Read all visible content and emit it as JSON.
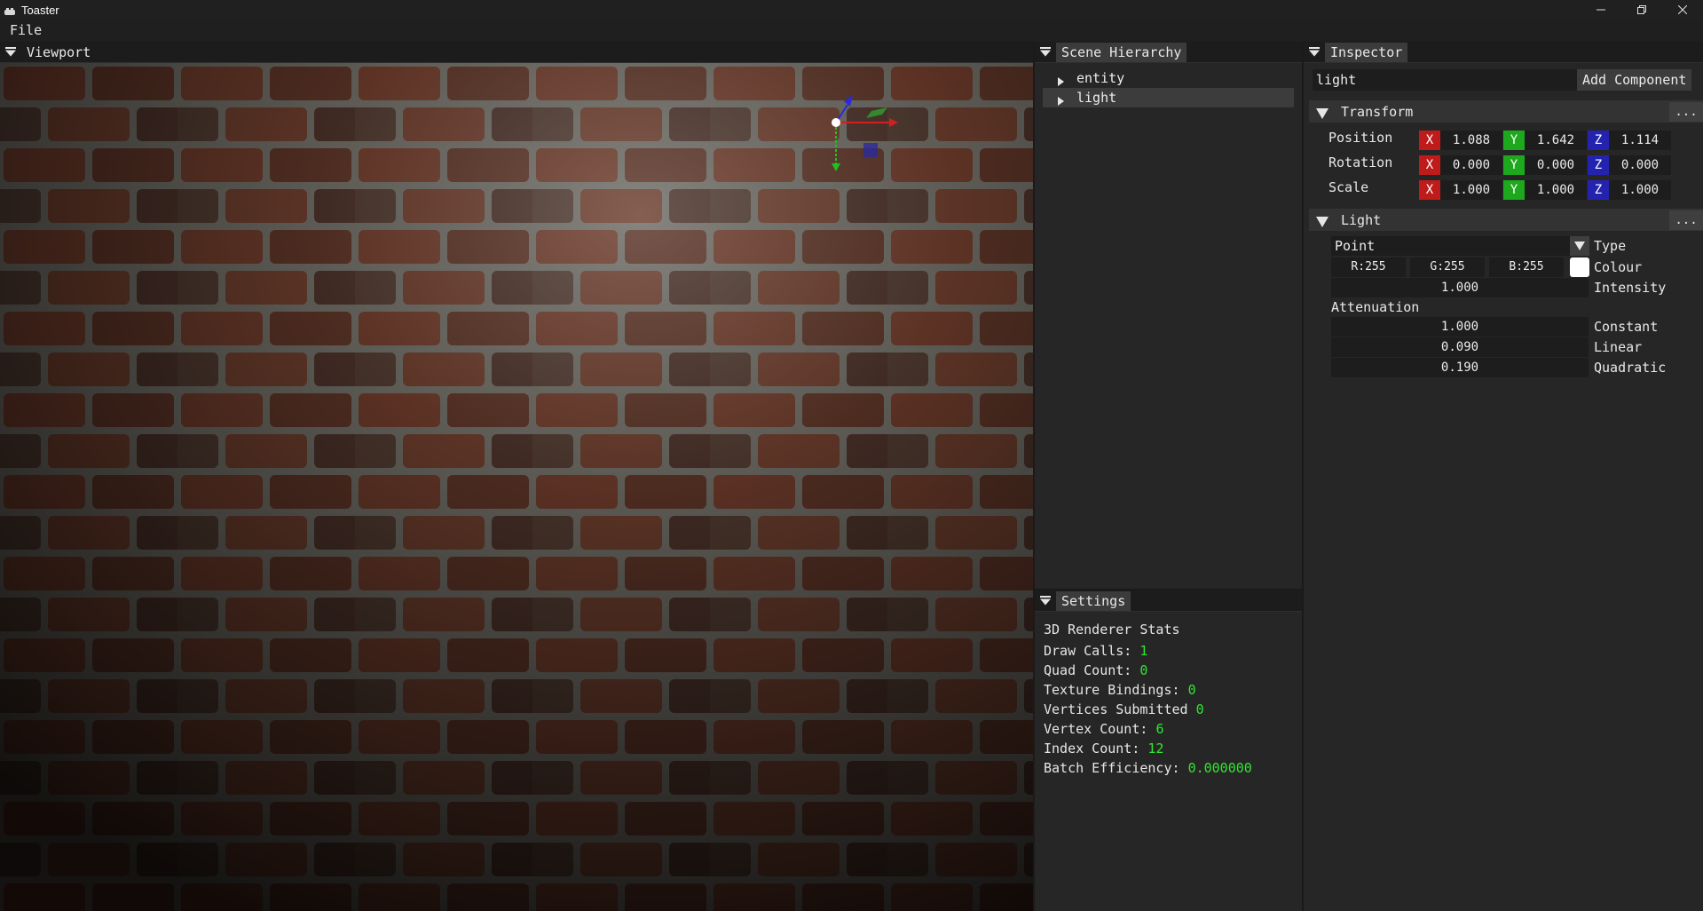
{
  "window": {
    "title": "Toaster",
    "minimize": "—",
    "maximize": "❐",
    "close": "✕"
  },
  "menu": {
    "file": "File"
  },
  "viewport": {
    "tab": "Viewport"
  },
  "hierarchy": {
    "tab": "Scene Hierarchy",
    "items": [
      {
        "label": "entity",
        "selected": false
      },
      {
        "label": "light",
        "selected": true
      }
    ]
  },
  "settings": {
    "tab": "Settings",
    "heading": "3D Renderer Stats",
    "stats": [
      {
        "label": "Draw Calls:",
        "value": "1"
      },
      {
        "label": "Quad Count:",
        "value": "0"
      },
      {
        "label": "Texture Bindings:",
        "value": "0"
      },
      {
        "label": "Vertices Submitted",
        "value": "0"
      },
      {
        "label": "Vertex Count:",
        "value": "6"
      },
      {
        "label": "Index Count:",
        "value": "12"
      },
      {
        "label": "Batch Efficiency:",
        "value": "0.000000"
      }
    ]
  },
  "inspector": {
    "tab": "Inspector",
    "entity_name": "light",
    "add_component": "Add Component",
    "more": "...",
    "transform": {
      "title": "Transform",
      "axis_x": "X",
      "axis_y": "Y",
      "axis_z": "Z",
      "position": {
        "label": "Position",
        "x": "1.088",
        "y": "1.642",
        "z": "1.114"
      },
      "rotation": {
        "label": "Rotation",
        "x": "0.000",
        "y": "0.000",
        "z": "0.000"
      },
      "scale": {
        "label": "Scale",
        "x": "1.000",
        "y": "1.000",
        "z": "1.000"
      }
    },
    "light": {
      "title": "Light",
      "type_value": "Point",
      "type_label": "Type",
      "r": "R:255",
      "g": "G:255",
      "b": "B:255",
      "colour_label": "Colour",
      "colour_hex": "#ffffff",
      "intensity_value": "1.000",
      "intensity_label": "Intensity",
      "attenuation_label": "Attenuation",
      "constant_value": "1.000",
      "constant_label": "Constant",
      "linear_value": "0.090",
      "linear_label": "Linear",
      "quadratic_value": "0.190",
      "quadratic_label": "Quadratic"
    }
  },
  "colors": {
    "stat_value": "#2ee82e",
    "axis_x": "#bf1b1b",
    "axis_y": "#1da81d",
    "axis_z": "#2323b0"
  }
}
